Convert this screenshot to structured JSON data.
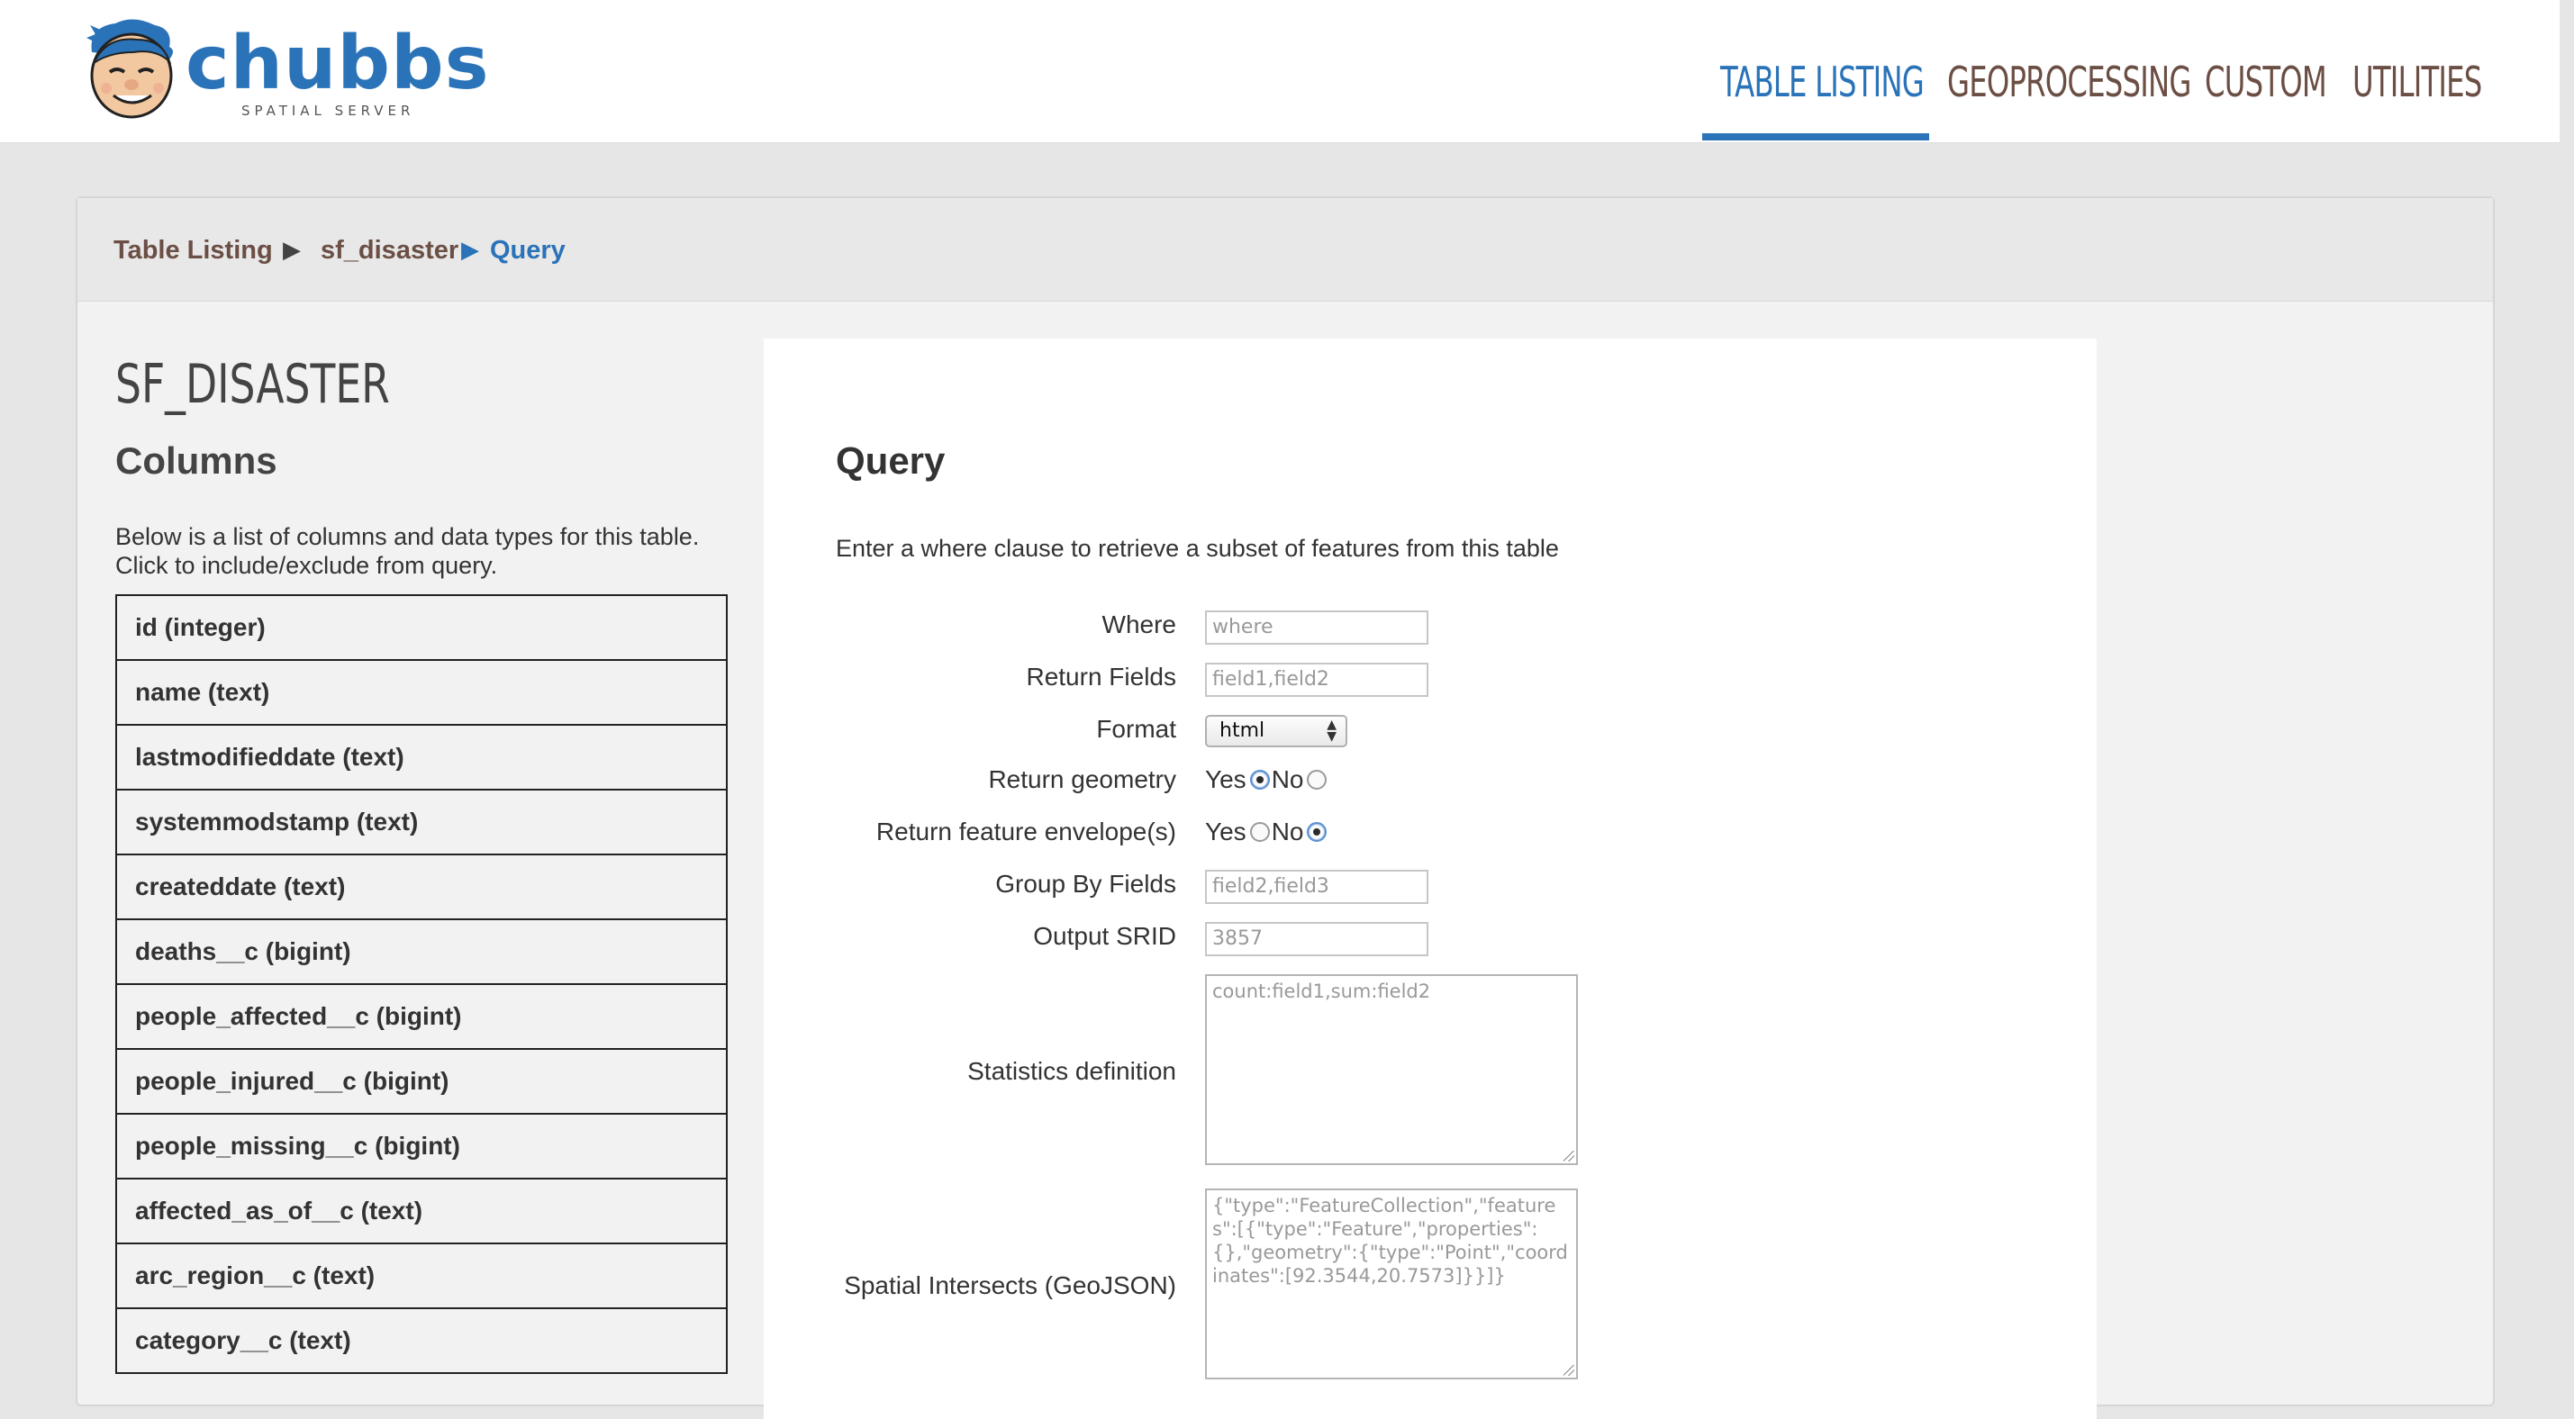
{
  "brand": {
    "name": "chubbs",
    "tagline": "SPATIAL SERVER"
  },
  "nav": {
    "items": [
      {
        "label": "TABLE LISTING",
        "active": true
      },
      {
        "label": "GEOPROCESSING",
        "active": false
      },
      {
        "label": "CUSTOM",
        "active": false
      },
      {
        "label": "UTILITIES",
        "active": false
      }
    ]
  },
  "breadcrumb": {
    "items": [
      "Table Listing",
      "sf_disaster",
      "Query"
    ]
  },
  "table": {
    "title": "SF_DISASTER",
    "columns_heading": "Columns",
    "columns_description": "Below is a list of columns and data types for this table. Click to include/exclude from query.",
    "columns": [
      "id (integer)",
      "name (text)",
      "lastmodifieddate (text)",
      "systemmodstamp (text)",
      "createddate (text)",
      "deaths__c (bigint)",
      "people_affected__c (bigint)",
      "people_injured__c (bigint)",
      "people_missing__c (bigint)",
      "affected_as_of__c (text)",
      "arc_region__c (text)",
      "category__c (text)"
    ]
  },
  "query": {
    "heading": "Query",
    "description": "Enter a where clause to retrieve a subset of features from this table",
    "where": {
      "label": "Where",
      "placeholder": "where"
    },
    "return_fields": {
      "label": "Return Fields",
      "placeholder": "field1,field2"
    },
    "format": {
      "label": "Format",
      "value": "html"
    },
    "return_geometry": {
      "label": "Return geometry",
      "yes": "Yes",
      "no": "No",
      "selected": "yes"
    },
    "return_envelope": {
      "label": "Return feature envelope(s)",
      "yes": "Yes",
      "no": "No",
      "selected": "no"
    },
    "group_by": {
      "label": "Group By Fields",
      "placeholder": "field2,field3"
    },
    "output_srid": {
      "label": "Output SRID",
      "placeholder": "3857"
    },
    "statistics": {
      "label": "Statistics definition",
      "placeholder": "count:field1,sum:field2"
    },
    "spatial": {
      "label": "Spatial Intersects (GeoJSON)",
      "placeholder": "{\"type\":\"FeatureCollection\",\"features\":[{\"type\":\"Feature\",\"properties\":{},\"geometry\":{\"type\":\"Point\",\"coordinates\":[92.3544,20.7573]}}]}"
    }
  },
  "colors": {
    "accent": "#2a73b8",
    "brown": "#6b4e44"
  }
}
